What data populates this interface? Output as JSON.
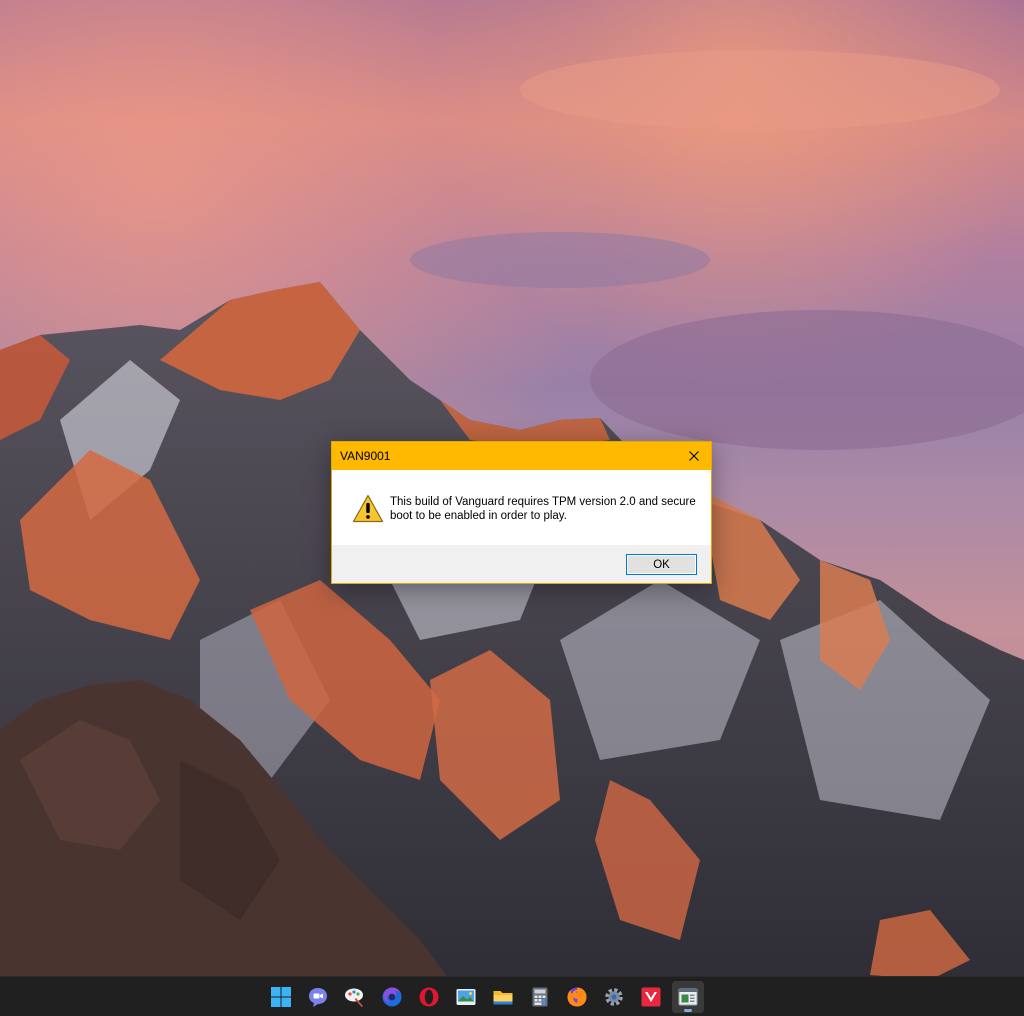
{
  "dialog": {
    "title": "VAN9001",
    "message": "This build of Vanguard requires TPM version 2.0 and secure boot to be enabled in order to play.",
    "ok_label": "OK",
    "icon": "warning-icon",
    "title_bar_color": "#ffb900"
  },
  "taskbar": {
    "icons": [
      "start-icon",
      "chat-icon",
      "paint-icon",
      "firefox-developer-icon",
      "opera-icon",
      "photo-viewer-icon",
      "file-explorer-icon",
      "calculator-icon",
      "firefox-icon",
      "settings-icon",
      "vanguard-icon",
      "app-window-icon"
    ]
  }
}
